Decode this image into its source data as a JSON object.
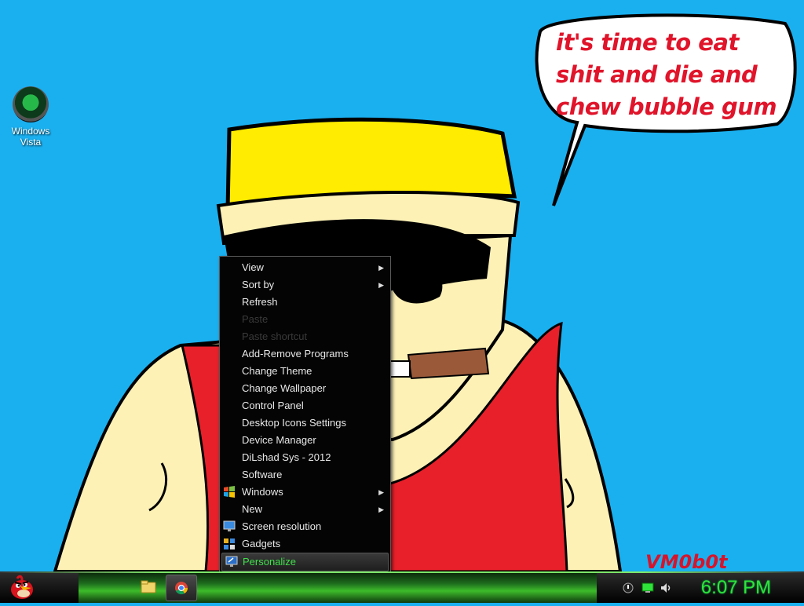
{
  "desktop": {
    "icons": [
      {
        "label": "Windows Vista",
        "icon": "vista-orb-icon"
      }
    ],
    "speech_bubble_text": "it's time to eat shit and die and chew bubble gum",
    "signature": "VM0b0t"
  },
  "context_menu": {
    "items": [
      {
        "label": "View",
        "submenu": true,
        "enabled": true
      },
      {
        "label": "Sort by",
        "submenu": true,
        "enabled": true
      },
      {
        "label": "Refresh",
        "enabled": true
      },
      {
        "label": "Paste",
        "enabled": false
      },
      {
        "label": "Paste shortcut",
        "enabled": false
      },
      {
        "label": "Add-Remove Programs",
        "enabled": true
      },
      {
        "label": "Change Theme",
        "enabled": true
      },
      {
        "label": "Change Wallpaper",
        "enabled": true
      },
      {
        "label": "Control Panel",
        "enabled": true
      },
      {
        "label": "Desktop Icons Settings",
        "enabled": true
      },
      {
        "label": "Device Manager",
        "enabled": true
      },
      {
        "label": "DiLshad Sys - 2012",
        "enabled": true
      },
      {
        "label": "Software",
        "enabled": true
      },
      {
        "label": "Windows",
        "submenu": true,
        "enabled": true,
        "icon": "windows-flag-icon"
      },
      {
        "label": "New",
        "submenu": true,
        "enabled": true
      },
      {
        "label": "Screen resolution",
        "enabled": true,
        "icon": "monitor-icon"
      },
      {
        "label": "Gadgets",
        "enabled": true,
        "icon": "gadgets-icon"
      },
      {
        "label": "Personalize",
        "enabled": true,
        "icon": "personalize-icon",
        "highlighted": true
      }
    ]
  },
  "taskbar": {
    "start_icon": "angry-bird-icon",
    "pinned": [
      {
        "name": "explorer",
        "icon": "folder-icon"
      },
      {
        "name": "chrome",
        "icon": "chrome-icon",
        "active": true
      }
    ],
    "tray": [
      {
        "icon": "action-center-icon"
      },
      {
        "icon": "network-icon"
      },
      {
        "icon": "volume-icon"
      }
    ],
    "clock": "6:07 PM"
  },
  "colors": {
    "desktop_bg": "#1ab0f0",
    "menu_bg": "#040404",
    "accent_green": "#2fe33a",
    "bubble_text": "#e0142a"
  }
}
